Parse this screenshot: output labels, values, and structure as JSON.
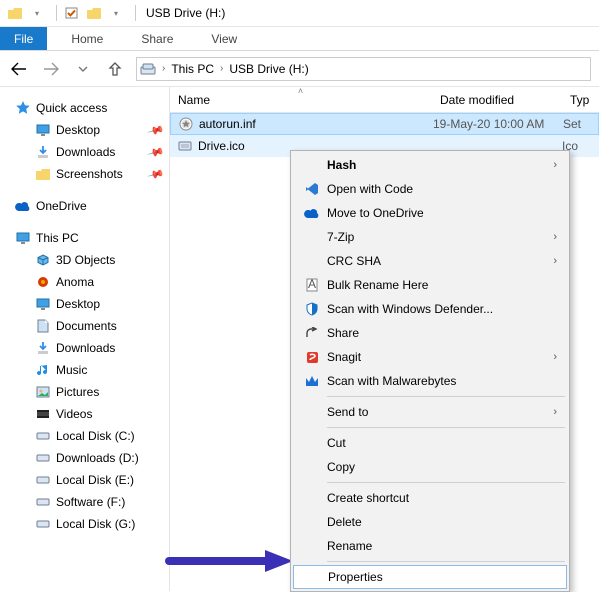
{
  "titlebar": {
    "title": "USB Drive (H:)"
  },
  "ribbon": {
    "file": "File",
    "home": "Home",
    "share": "Share",
    "view": "View"
  },
  "breadcrumb": {
    "root": "This PC",
    "leaf": "USB Drive (H:)"
  },
  "columns": {
    "name": "Name",
    "date": "Date modified",
    "type": "Typ"
  },
  "files": [
    {
      "name": "autorun.inf",
      "date": "19-May-20 10:00 AM",
      "type": "Set"
    },
    {
      "name": "Drive.ico",
      "date": "",
      "type": "Ico"
    }
  ],
  "tree": {
    "quick_access": "Quick access",
    "desktop": "Desktop",
    "downloads": "Downloads",
    "screenshots": "Screenshots",
    "onedrive": "OneDrive",
    "thispc": "This PC",
    "three_d": "3D Objects",
    "anoma": "Anoma",
    "desktop2": "Desktop",
    "documents": "Documents",
    "downloads2": "Downloads",
    "music": "Music",
    "pictures": "Pictures",
    "videos": "Videos",
    "disk_c": "Local Disk (C:)",
    "disk_d": "Downloads  (D:)",
    "disk_e": "Local Disk (E:)",
    "disk_f": "Software (F:)",
    "disk_g": "Local Disk (G:)"
  },
  "context_menu": {
    "hash": "Hash",
    "open_code": "Open with Code",
    "onedrive": "Move to OneDrive",
    "sevenzip": "7-Zip",
    "crc": "CRC SHA",
    "bulk_rename": "Bulk Rename Here",
    "defender": "Scan with Windows Defender...",
    "share": "Share",
    "snagit": "Snagit",
    "malwarebytes": "Scan with Malwarebytes",
    "send_to": "Send to",
    "cut": "Cut",
    "copy": "Copy",
    "shortcut": "Create shortcut",
    "delete": "Delete",
    "rename": "Rename",
    "properties": "Properties"
  },
  "colors": {
    "file_tab": "#1979ca",
    "selection": "#cce8ff",
    "arrow": "#3b2fb5"
  }
}
